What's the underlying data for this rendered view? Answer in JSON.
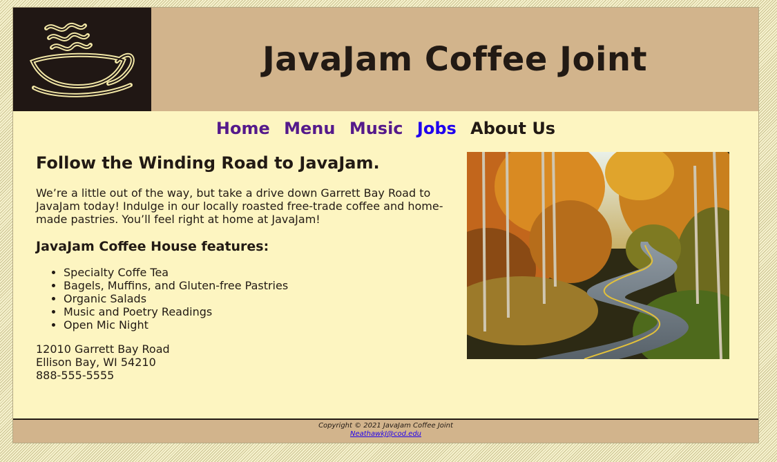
{
  "header": {
    "title": "JavaJam Coffee Joint",
    "logo_icon": "coffee-cup-icon"
  },
  "nav": {
    "items": [
      "Home",
      "Menu",
      "Music",
      "Jobs",
      "About Us"
    ]
  },
  "main": {
    "heading": "Follow the Winding Road to JavaJam.",
    "intro": "We’re a little out of the way, but take a drive down Garrett Bay Road to JavaJam today! Indulge in our locally roasted free-trade coffee and home-made pastries. You’ll feel right at home at JavaJam!",
    "features_heading": "JavaJam Coffee House features:",
    "features": [
      "Specialty Coffe Tea",
      "Bagels, Muffins, and Gluten-free Pastries",
      "Organic Salads",
      "Music and Poetry Readings",
      "Open Mic Night"
    ],
    "address": [
      "12010 Garrett Bay Road",
      "Ellison Bay, WI 54210",
      "888-555-5555"
    ]
  },
  "footer": {
    "copyright": "Copyright © 2021 JavaJam Coffee Joint",
    "email": "NeathawkJ@cod.edu"
  },
  "colors": {
    "header_bg": "#d2b48c",
    "content_bg": "#fdf5c1",
    "text": "#221a14",
    "visited_link": "#551a8b",
    "link": "#1f00ee"
  }
}
